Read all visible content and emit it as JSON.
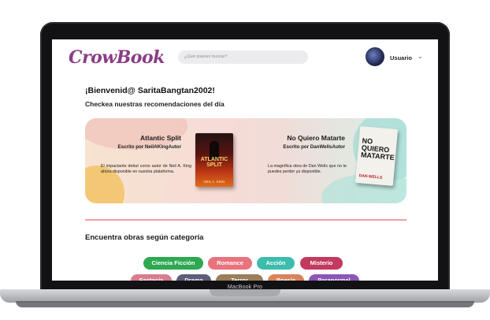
{
  "app": {
    "logo": "CrowBook",
    "search_placeholder": "¿Qué quieres buscar?",
    "user_name": "Usuario"
  },
  "welcome": {
    "greeting": "¡Bienvenid@ SaritaBangtan2002!",
    "subtitle": "Checkea nuestras recomendaciones del día"
  },
  "recommendations": [
    {
      "title": "Atlantic Split",
      "author_line": "Escrito por NeilAKingAutor",
      "description": "El impactante debut como autor de Neil A. King ahora disponible en nuestra plataforma.",
      "cover_title": "ATLANTIC SPLIT",
      "cover_author": "NEIL A. KING"
    },
    {
      "title": "No Quiero Matarte",
      "author_line": "Escrito por DanWellsAutor",
      "description": "La magnífica obra de Dan Wells que no te puedes perder ya disponible.",
      "cover_title": "NO QUIERO MATARTE",
      "cover_author": "DAN WELLS"
    }
  ],
  "categories": {
    "heading": "Encuentra obras según categoría",
    "chips": [
      {
        "label": "Ciencia Ficción",
        "color": "#2ea851"
      },
      {
        "label": "Romance",
        "color": "#e8737c"
      },
      {
        "label": "Acción",
        "color": "#3dbcae"
      },
      {
        "label": "Misterio",
        "color": "#c23a5e"
      },
      {
        "label": "Fantasía",
        "color": "#d67d8e"
      },
      {
        "label": "Drama",
        "color": "#5c5f7a"
      },
      {
        "label": "Terror",
        "color": "#9a7f5a"
      },
      {
        "label": "Poesía",
        "color": "#d9835b"
      },
      {
        "label": "Paranormal",
        "color": "#8a57b8"
      }
    ]
  },
  "device": {
    "model": "MacBook Pro"
  }
}
